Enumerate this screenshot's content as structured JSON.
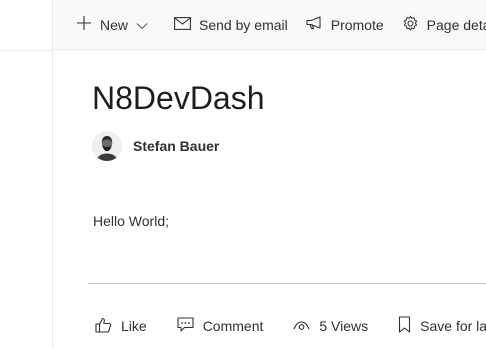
{
  "command_bar": {
    "new_label": "New",
    "send_email_label": "Send by email",
    "promote_label": "Promote",
    "page_details_label": "Page details"
  },
  "page": {
    "title": "N8DevDash",
    "author_name": "Stefan Bauer",
    "body_text": "Hello World;"
  },
  "social_bar": {
    "like_label": "Like",
    "comment_label": "Comment",
    "views_label": "5 Views",
    "save_label": "Save for later"
  },
  "icons": {
    "new": "plus-icon",
    "new_dropdown": "chevron-down-icon",
    "send_email": "mail-icon",
    "promote": "megaphone-icon",
    "page_details": "gear-icon",
    "like": "thumbs-up-icon",
    "comment": "comment-icon",
    "views": "eye-icon",
    "save": "bookmark-icon"
  }
}
